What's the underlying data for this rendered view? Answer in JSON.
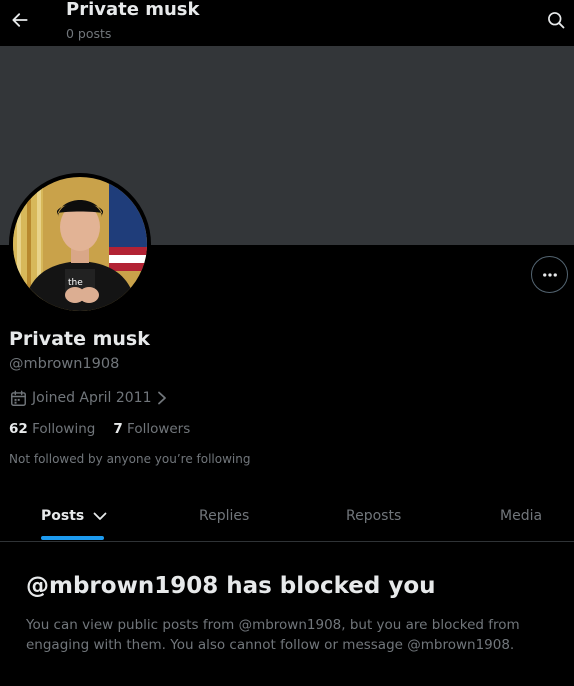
{
  "header": {
    "title": "Private musk",
    "post_count": "0 posts",
    "back_icon": "arrow-left-icon",
    "search_icon": "search-icon"
  },
  "profile": {
    "display_name": "Private musk",
    "handle": "@mbrown1908",
    "joined": "Joined April 2011",
    "following_count": "62",
    "following_label": "Following",
    "followers_count": "7",
    "followers_label": "Followers",
    "not_followed_text": "Not followed by anyone you’re following"
  },
  "tabs": [
    {
      "label": "Posts",
      "active": true
    },
    {
      "label": "Replies",
      "active": false
    },
    {
      "label": "Reposts",
      "active": false
    },
    {
      "label": "Media",
      "active": false
    }
  ],
  "blocked": {
    "title": "@mbrown1908 has blocked you",
    "message": "You can view public posts from @mbrown1908, but you are blocked from engaging with them. You also cannot follow or message @mbrown1908."
  },
  "colors": {
    "background": "#000000",
    "banner": "#333639",
    "text_primary": "#e7e9ea",
    "text_secondary": "#71767b",
    "accent": "#1d9bf0"
  }
}
